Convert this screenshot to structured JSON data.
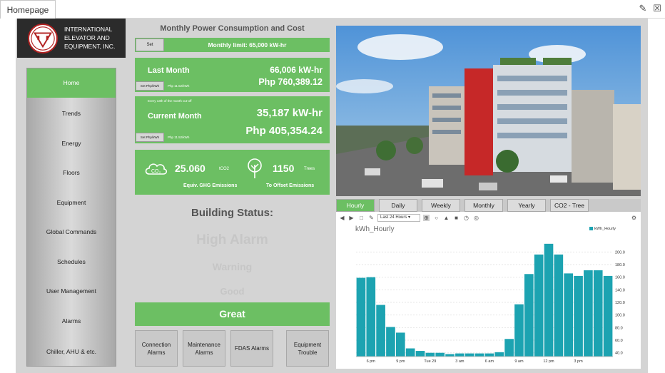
{
  "tab": {
    "title": "Homepage"
  },
  "company": {
    "name_lines": [
      "INTERNATIONAL",
      "ELEVATOR AND",
      "EQUIPMENT, INC."
    ]
  },
  "nav": {
    "items": [
      "Home",
      "Trends",
      "Energy",
      "Floors",
      "Equipment",
      "Global Commands",
      "Schedules",
      "User Management",
      "Alarms",
      "Chiller, AHU & etc."
    ],
    "active": "Home"
  },
  "power": {
    "title": "Monthly Power Consumption and Cost",
    "set_label": "Set",
    "limit_text": "Monthly limit: 65,000 kW-hr",
    "last_month": {
      "label": "Last Month",
      "kwh": "66,006 kW-hr",
      "php": "Php 760,389.12",
      "set_btn": "Set Php/kWh",
      "rate": "Php 11.52/kWh"
    },
    "current_month": {
      "cutoff": "Every 13th of the month cut-off",
      "label": "Current Month",
      "kwh": "35,187 kW-hr",
      "php": "Php 405,354.24",
      "set_btn": "Set Php/kWh",
      "rate": "Php 11.52/kWh"
    }
  },
  "emissions": {
    "co2_value": "25.060",
    "co2_unit": "tCO2",
    "co2_label": "Equiv. GHG Emissions",
    "trees_value": "1150",
    "trees_unit": "Trees",
    "trees_label": "To Offset Emissions",
    "co2_icon": "cloud-co2-icon",
    "tree_icon": "tree-icon"
  },
  "status": {
    "title": "Building Status:",
    "levels": [
      "High Alarm",
      "Warning",
      "Good",
      "Great"
    ],
    "current": "Great"
  },
  "alarm_buttons": [
    "Connection Alarms",
    "Maintenance Alarms",
    "FDAS Alarms",
    "Equipment Trouble"
  ],
  "range_tabs": {
    "items": [
      "Hourly",
      "Daily",
      "Weekly",
      "Monthly",
      "Yearly",
      "CO2 - Tree"
    ],
    "active": "Hourly"
  },
  "chart_toolbar": {
    "period": "Last 24 Hours"
  },
  "colors": {
    "accent_green": "#6cbf63",
    "bar": "#1ca3b1",
    "panel_gray": "#d4d4d4"
  },
  "chart_data": {
    "type": "bar",
    "title": "kWh_Hourly",
    "series": [
      {
        "name": "kWh_Hourly",
        "values": [
          159,
          160,
          116,
          81,
          72,
          47,
          43,
          40,
          40,
          38,
          39,
          39,
          39,
          39,
          41,
          62,
          117,
          165,
          196,
          213,
          196,
          166,
          162,
          171,
          171,
          162
        ]
      }
    ],
    "x_tick_labels": [
      "6 pm",
      "9 pm",
      "Tue 29",
      "3 am",
      "6 am",
      "9 am",
      "12 pm",
      "3 pm"
    ],
    "y_ticks": [
      40.0,
      60.0,
      80.0,
      100.0,
      120.0,
      140.0,
      160.0,
      180.0,
      200.0
    ],
    "ylim": [
      34,
      223
    ],
    "grid": true,
    "legend": "top-right"
  }
}
